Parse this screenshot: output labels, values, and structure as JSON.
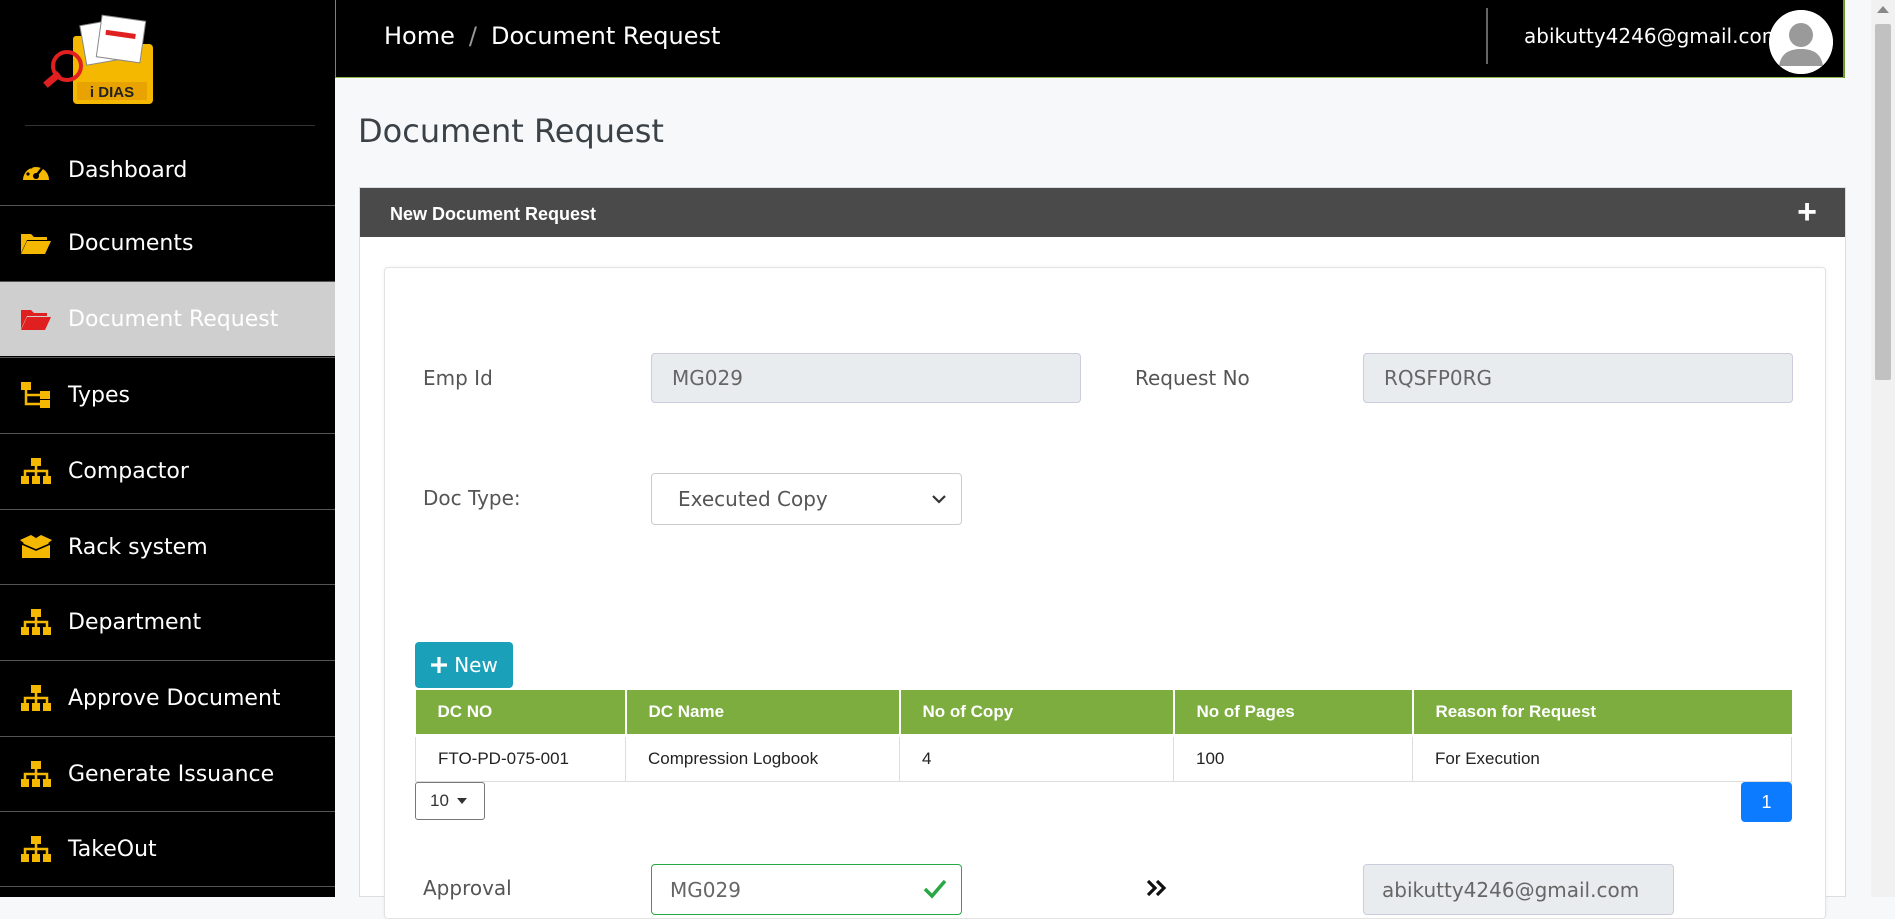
{
  "logo": {
    "text": "i DIAS"
  },
  "sidebar": {
    "items": [
      {
        "label": "Dashboard",
        "icon": "dashboard-gauge-icon",
        "active": false
      },
      {
        "label": "Documents",
        "icon": "folder-open-icon",
        "active": false
      },
      {
        "label": "Document Request",
        "icon": "folder-open-icon",
        "active": true
      },
      {
        "label": "Types",
        "icon": "hierarchy-icon",
        "active": false
      },
      {
        "label": "Compactor",
        "icon": "sitemap-icon",
        "active": false
      },
      {
        "label": "Rack system",
        "icon": "box-open-icon",
        "active": false
      },
      {
        "label": "Department",
        "icon": "sitemap-icon",
        "active": false
      },
      {
        "label": "Approve Document",
        "icon": "sitemap-icon",
        "active": false
      },
      {
        "label": "Generate Issuance",
        "icon": "sitemap-icon",
        "active": false
      },
      {
        "label": "TakeOut",
        "icon": "sitemap-icon",
        "active": false
      }
    ],
    "icon_color": "#f5b800",
    "active_icon_color": "#e02020"
  },
  "header": {
    "breadcrumb": {
      "home": "Home",
      "separator": "/",
      "current": "Document Request"
    },
    "user_email": "abikutty4246@gmail.com"
  },
  "page": {
    "title": "Document Request"
  },
  "card": {
    "title": "New Document Request",
    "expand_symbol": "+"
  },
  "form": {
    "emp_id_label": "Emp Id",
    "emp_id_value": "MG029",
    "request_no_label": "Request No",
    "request_no_value": "RQSFP0RG",
    "doc_type_label": "Doc Type:",
    "doc_type_value": "Executed Copy",
    "new_button": "New",
    "approval_label": "Approval",
    "approval_value": "MG029",
    "approver_email": "abikutty4246@gmail.com"
  },
  "table": {
    "columns": [
      "DC NO",
      "DC Name",
      "No of Copy",
      "No of Pages",
      "Reason for Request"
    ],
    "rows": [
      [
        "FTO-PD-075-001",
        "Compression Logbook",
        "4",
        "100",
        "For Execution"
      ]
    ]
  },
  "pagination": {
    "page_size": "10",
    "current_page": "1"
  },
  "colors": {
    "header_green": "#7cad3e",
    "card_header": "#4a4a4a",
    "primary": "#0d7bff",
    "info": "#1ba0b9"
  }
}
